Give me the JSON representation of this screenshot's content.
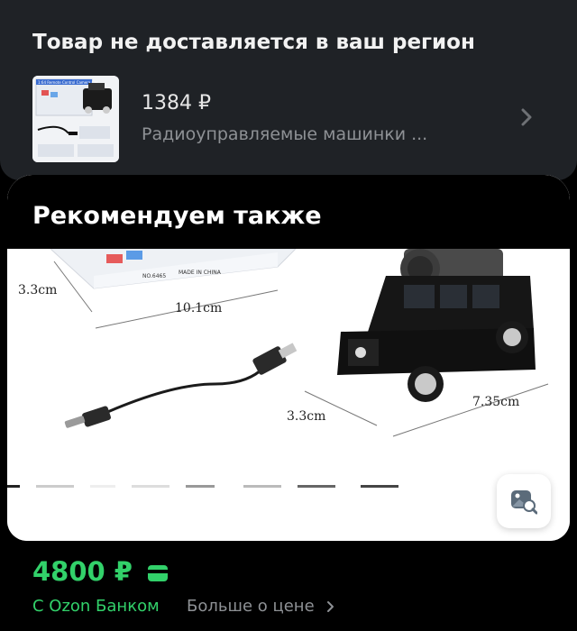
{
  "unavailable": {
    "title": "Товар не доставляется в ваш регион",
    "product": {
      "price": "1384 ₽",
      "name": "Радиоуправляемые машинки ...",
      "thumb_label": "1:64 Remote Control Camera Car"
    }
  },
  "recommend": {
    "title": "Рекомендуем также",
    "image_labels": {
      "box_height": "3.3cm",
      "box_width": "10.1cm",
      "car_height": "3.3cm",
      "car_length": "7.35cm",
      "box_model": "NO.6465",
      "box_origin": "MADE IN CHINA"
    }
  },
  "price_block": {
    "price": "4800 ₽",
    "ozon_bank": "С Ozon Банком",
    "more_link": "Больше о цене"
  },
  "colors": {
    "accent_green": "#32d16a",
    "card_dark": "#1f2226"
  },
  "icons": [
    "chevron-right-icon",
    "image-search-icon",
    "wallet-card-icon"
  ]
}
